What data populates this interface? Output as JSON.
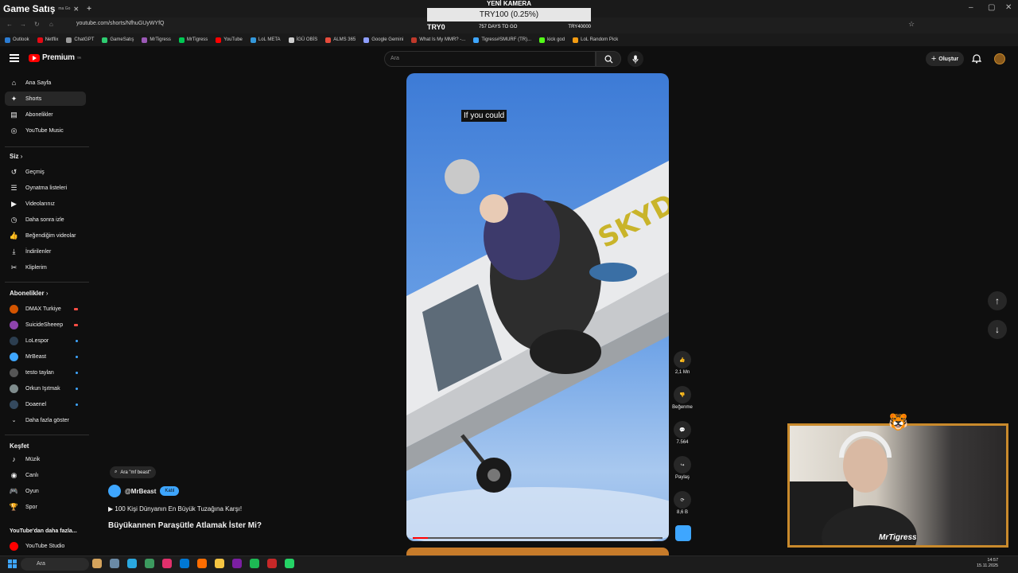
{
  "browser": {
    "tab_title": "Game Satış",
    "tab_sub": "ma Go",
    "url": "youtube.com/shorts/NfhuGUyWYfQ",
    "bookmarks": [
      {
        "label": "Outlook",
        "color": "#2b7cd3"
      },
      {
        "label": "Netflix",
        "color": "#e50914"
      },
      {
        "label": "ChatGPT",
        "color": "#9a9a9a"
      },
      {
        "label": "GameSatış",
        "color": "#2ecc71"
      },
      {
        "label": "MrTigress",
        "color": "#9b59b6"
      },
      {
        "label": "MrTigress",
        "color": "#00c853"
      },
      {
        "label": "YouTube",
        "color": "#ff0000"
      },
      {
        "label": "LoL META",
        "color": "#3498db"
      },
      {
        "label": "İGÜ OBİS",
        "color": "#cfcfcf"
      },
      {
        "label": "ALMS 365",
        "color": "#e74c3c"
      },
      {
        "label": "Google Gemini",
        "color": "#8e9eff"
      },
      {
        "label": "What Is My MMR? -...",
        "color": "#c0392b"
      },
      {
        "label": "Tigress#SMURF (TR)...",
        "color": "#3ea6ff"
      },
      {
        "label": "kick god",
        "color": "#53fc18"
      },
      {
        "label": "LoL Random Pick",
        "color": "#f39c12"
      }
    ]
  },
  "overlay": {
    "title": "YENİ KAMERA",
    "progress_text": "TRY100 (0.25%)",
    "progress": 0.25,
    "left": "TRY0",
    "center": "757 DAYS TO GO",
    "right": "TRY40000"
  },
  "header": {
    "logo": "Premium",
    "logo_region": "TR",
    "search_placeholder": "Ara",
    "create_label": "Oluştur"
  },
  "sidebar": {
    "main": [
      {
        "label": "Ana Sayfa",
        "icon": "home-icon"
      },
      {
        "label": "Shorts",
        "icon": "shorts-icon"
      },
      {
        "label": "Abonelikler",
        "icon": "subscriptions-icon"
      },
      {
        "label": "YouTube Music",
        "icon": "music-icon"
      }
    ],
    "you_title": "Siz",
    "you": [
      {
        "label": "Geçmiş",
        "icon": "history-icon"
      },
      {
        "label": "Oynatma listeleri",
        "icon": "playlist-icon"
      },
      {
        "label": "Videolarınız",
        "icon": "videos-icon"
      },
      {
        "label": "Daha sonra izle",
        "icon": "clock-icon"
      },
      {
        "label": "Beğendiğim videolar",
        "icon": "like-icon"
      },
      {
        "label": "İndirilenler",
        "icon": "download-icon"
      },
      {
        "label": "Kliplerim",
        "icon": "scissors-icon"
      }
    ],
    "subs_title": "Abonelikler",
    "subs": [
      {
        "label": "DMAX Turkiye",
        "color": "#d35400",
        "badge": "live"
      },
      {
        "label": "SuicideSheeep",
        "color": "#8e44ad",
        "badge": "live"
      },
      {
        "label": "LoLespor",
        "color": "#2c3e50",
        "badge": "dot"
      },
      {
        "label": "MrBeast",
        "color": "#3ea6ff",
        "badge": "dot"
      },
      {
        "label": "testo taylan",
        "color": "#555555",
        "badge": "dot"
      },
      {
        "label": "Orkun Işıtmak",
        "color": "#7f8c8d",
        "badge": "dot"
      },
      {
        "label": "Doaenel",
        "color": "#34495e",
        "badge": "dot"
      }
    ],
    "more_label": "Daha fazla göster",
    "explore_title": "Keşfet",
    "explore": [
      {
        "label": "Müzik",
        "icon": "music-note-icon"
      },
      {
        "label": "Canlı",
        "icon": "live-icon"
      },
      {
        "label": "Oyun",
        "icon": "gamepad-icon"
      },
      {
        "label": "Spor",
        "icon": "trophy-icon"
      }
    ],
    "more_from": "YouTube'dan daha fazla...",
    "studio": "YouTube Studio"
  },
  "short": {
    "caption": "If you could",
    "search_chip": "Ara \"mf beast\"",
    "channel": "@MrBeast",
    "join": "Katıl",
    "playlist": "100 Kişi Dünyanın En Büyük Tuzağına Karşı!",
    "title": "Büyükannen Paraşütle Atlamak İster Mi?",
    "plane_text": "SKYD",
    "actions": {
      "likes": "2,1 Mn",
      "dislike": "Beğenme",
      "comments": "7.564",
      "share": "Paylaş",
      "remix": "8,6 B"
    }
  },
  "webcam": {
    "name": "MrTigress"
  },
  "taskbar": {
    "search": "Ara",
    "time": "14:57",
    "date": "15.11.2025"
  }
}
